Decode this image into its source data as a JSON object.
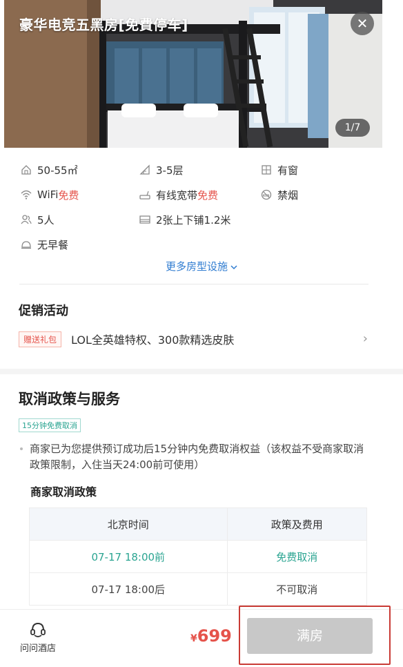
{
  "room": {
    "title": "豪华电竞五黑房[免費停车]",
    "photo_counter": "1/7",
    "close_icon": "close-icon"
  },
  "facilities": {
    "area": "50-55㎡",
    "floor": "3-5层",
    "window": "有窗",
    "wifi_label": "WiFi",
    "wifi_free": "免费",
    "broadband_label": "有线宽带",
    "broadband_free": "免费",
    "smoking": "禁烟",
    "guests": "5人",
    "bed": "2张上下铺1.2米",
    "breakfast": "无早餐",
    "more_link": "更多房型设施"
  },
  "promotion": {
    "title": "促销活动",
    "tag": "赠送礼包",
    "text": "LOL全英雄特权、300款精选皮肤"
  },
  "cancel_policy": {
    "title": "取消政策与服务",
    "tag": "15分钟免费取消",
    "bullet": "商家已为您提供预订成功后15分钟内免费取消权益（该权益不受商家取消政策限制，入住当天24:00前可使用）",
    "merchant_title": "商家取消政策",
    "table": {
      "headers": [
        "北京时间",
        "政策及费用"
      ],
      "rows": [
        [
          "07-17 18:00前",
          "免费取消"
        ],
        [
          "07-17 18:00后",
          "不可取消"
        ]
      ]
    }
  },
  "bottom_bar": {
    "ask_label": "问问酒店",
    "currency": "¥",
    "price": "699",
    "book_button": "满房"
  },
  "colors": {
    "accent_red": "#e5534b",
    "accent_teal": "#2aa491",
    "link_blue": "#2e7bd0",
    "highlight_red": "#c93a34"
  }
}
